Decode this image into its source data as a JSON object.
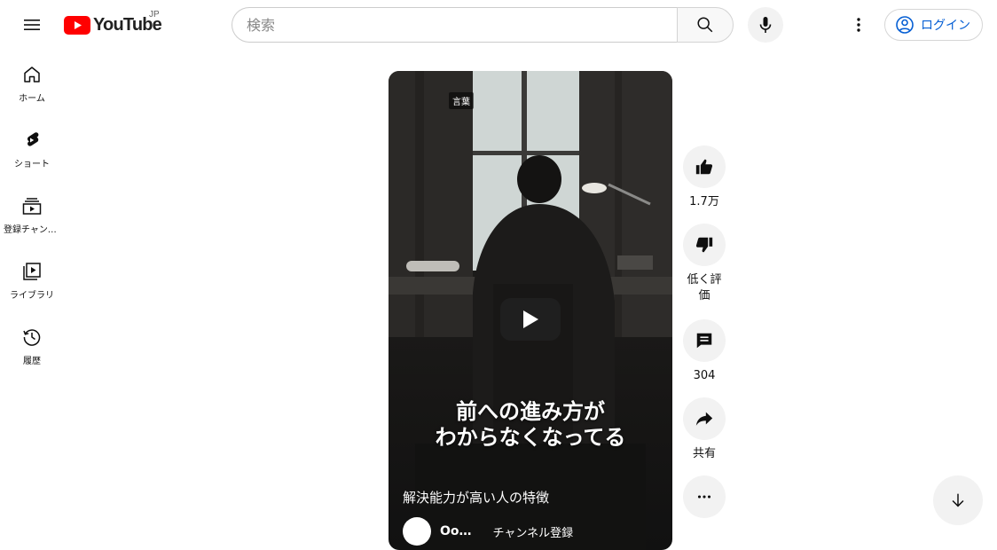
{
  "header": {
    "logo_text": "YouTube",
    "country_code": "JP",
    "search_placeholder": "検索",
    "login_label": "ログイン"
  },
  "sidebar": {
    "items": [
      {
        "label": "ホーム",
        "icon": "home-icon"
      },
      {
        "label": "ショート",
        "icon": "shorts-icon"
      },
      {
        "label": "登録チャンネル",
        "icon": "subscriptions-icon"
      },
      {
        "label": "ライブラリ",
        "icon": "library-icon"
      },
      {
        "label": "履歴",
        "icon": "history-icon"
      }
    ]
  },
  "video": {
    "tag": "言葉",
    "caption_line1": "前への進み方が",
    "caption_line2": "わからなくなってる",
    "title": "解決能力が高い人の特徴",
    "channel_name": "Oo…",
    "subscribe_label": "チャンネル登録"
  },
  "actions": {
    "like_count": "1.7万",
    "dislike_label": "低く評価",
    "comment_count": "304",
    "share_label": "共有"
  },
  "colors": {
    "brand_red": "#ff0000",
    "link_blue": "#065fd4",
    "button_grey": "#f2f2f2"
  }
}
